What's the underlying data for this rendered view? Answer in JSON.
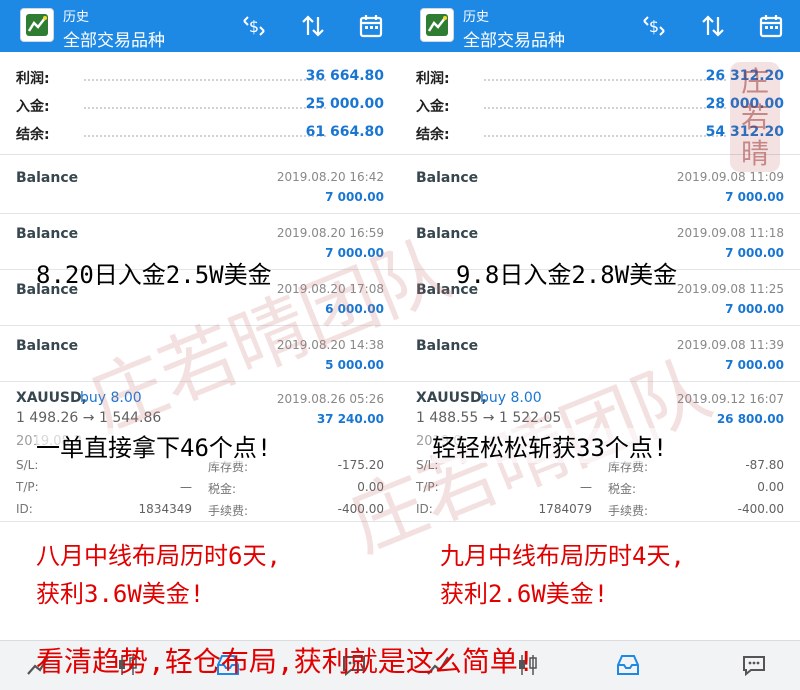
{
  "panels": [
    {
      "header": {
        "subtitle": "历史",
        "title": "全部交易品种"
      },
      "summary": [
        {
          "label": "利润:",
          "value": "36 664.80"
        },
        {
          "label": "入金:",
          "value": "25 000.00"
        },
        {
          "label": "结余:",
          "value": "61 664.80"
        }
      ],
      "balances": [
        {
          "name": "Balance",
          "date": "2019.08.20 16:42",
          "amount": "7 000.00"
        },
        {
          "name": "Balance",
          "date": "2019.08.20 16:59",
          "amount": "7 000.00"
        },
        {
          "name": "Balance",
          "date": "2019.08.20 17:08",
          "amount": "6 000.00"
        },
        {
          "name": "Balance",
          "date": "2019.08.20 14:38",
          "amount": "5 000.00"
        }
      ],
      "trade": {
        "symbol": "XAUUSD,",
        "side": "buy 8.00",
        "prices": "1 498.26 → 1 544.86",
        "close_date": "2019.08.26 05:26",
        "profit": "37 240.00",
        "open_date": "2019.08.2",
        "sl_label": "S/L:",
        "sl_value": "",
        "tp_label": "T/P:",
        "tp_value": "—",
        "id_label": "ID:",
        "id_value": "1834349",
        "swap_label": "库存费:",
        "swap_value": "-175.20",
        "tax_label": "税金:",
        "tax_value": "0.00",
        "fee_label": "手续费:",
        "fee_value": "-400.00"
      },
      "overlays": {
        "deposit_note": "8.20日入金2.5W美金",
        "trade_note": "一单直接拿下46个点!",
        "result_line1": "八月中线布局历时6天,",
        "result_line2": "获利3.6W美金!"
      }
    },
    {
      "header": {
        "subtitle": "历史",
        "title": "全部交易品种"
      },
      "summary": [
        {
          "label": "利润:",
          "value": "26 312.20"
        },
        {
          "label": "入金:",
          "value": "28 000.00"
        },
        {
          "label": "结余:",
          "value": "54 312.20"
        }
      ],
      "balances": [
        {
          "name": "Balance",
          "date": "2019.09.08 11:09",
          "amount": "7 000.00"
        },
        {
          "name": "Balance",
          "date": "2019.09.08 11:18",
          "amount": "7 000.00"
        },
        {
          "name": "Balance",
          "date": "2019.09.08 11:25",
          "amount": "7 000.00"
        },
        {
          "name": "Balance",
          "date": "2019.09.08 11:39",
          "amount": "7 000.00"
        }
      ],
      "trade": {
        "symbol": "XAUUSD,",
        "side": "buy 8.00",
        "prices": "1 488.55 → 1 522.05",
        "close_date": "2019.09.12 16:07",
        "profit": "26 800.00",
        "open_date": "2019.0",
        "sl_label": "S/L:",
        "sl_value": "",
        "tp_label": "T/P:",
        "tp_value": "—",
        "id_label": "ID:",
        "id_value": "1784079",
        "swap_label": "库存费:",
        "swap_value": "-87.80",
        "tax_label": "税金:",
        "tax_value": "0.00",
        "fee_label": "手续费:",
        "fee_value": "-400.00"
      },
      "overlays": {
        "deposit_note": "9.8日入金2.8W美金",
        "trade_note": "轻轻松松斩获33个点!",
        "result_line1": "九月中线布局历时4天,",
        "result_line2": "获利2.6W美金!"
      }
    }
  ],
  "banner": "看清趋势,轻仓布局,获利就是这么简单!",
  "watermark": "庄若晴团队",
  "seal_text": [
    "庄",
    "若",
    "晴"
  ],
  "colors": {
    "appbar": "#1e88e5",
    "value_blue": "#1976d2",
    "banner_red": "#e00000"
  },
  "icons": [
    "app-logo-icon",
    "currency-exchange-icon",
    "sort-icon",
    "calendar-icon",
    "chart-line-icon",
    "candlestick-icon",
    "inbox-icon",
    "chat-icon"
  ]
}
